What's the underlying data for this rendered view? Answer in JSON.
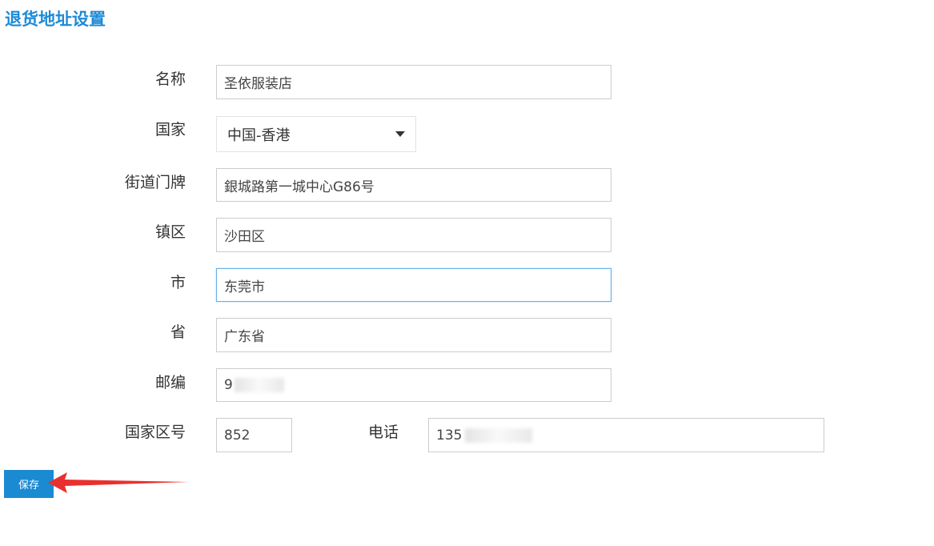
{
  "page": {
    "title": "退货地址设置"
  },
  "form": {
    "name": {
      "label": "名称",
      "value": "圣依服装店"
    },
    "country": {
      "label": "国家",
      "value": "中国-香港",
      "icon": "caret-down-icon"
    },
    "street": {
      "label": "街道门牌",
      "value": "銀城路第一城中心G86号"
    },
    "town": {
      "label": "镇区",
      "value": "沙田区"
    },
    "city": {
      "label": "市",
      "value": "东莞市"
    },
    "province": {
      "label": "省",
      "value": "广东省"
    },
    "postcode": {
      "label": "邮编",
      "value": "9"
    },
    "country_code": {
      "label": "国家区号",
      "value": "852"
    },
    "phone": {
      "label": "电话",
      "value": "135"
    }
  },
  "actions": {
    "save_label": "保存"
  },
  "colors": {
    "accent": "#1e8ad6",
    "annotation_arrow": "#e8312f",
    "focus_border": "#66afe9"
  }
}
